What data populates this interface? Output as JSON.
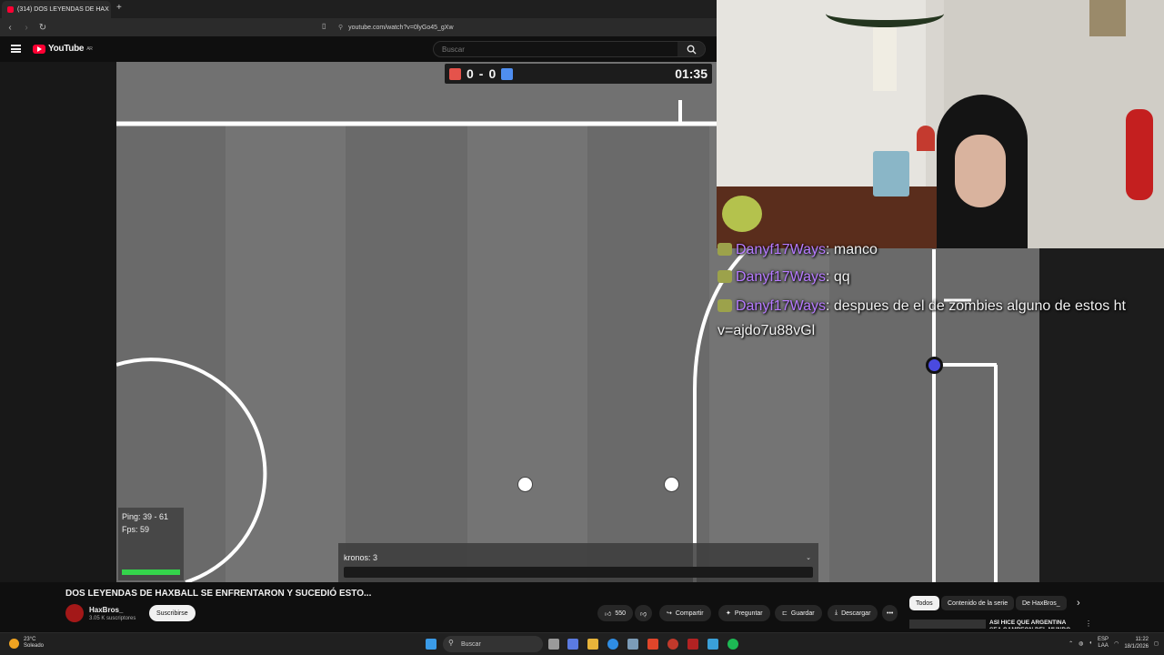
{
  "browser": {
    "tab_title": "(314) DOS LEYENDAS DE HAX",
    "tab_close": "×",
    "new_tab": "+",
    "url": "youtube.com/watch?v=0lyGo45_gXw"
  },
  "youtube": {
    "logo_text": "YouTube",
    "region": "AR",
    "search_placeholder": "Buscar"
  },
  "game": {
    "score_red": "0",
    "score_sep": "-",
    "score_blue": "0",
    "clock": "01:35",
    "ping": "Ping: 39 - 61",
    "fps": "Fps: 59",
    "chat_line": "kronos: 3",
    "colors": {
      "red": "#e5534b",
      "blue": "#4f8ef0",
      "player": "#4a4ae0"
    }
  },
  "stream_chat": [
    {
      "user": "Danyf17Ways",
      "text": "manco"
    },
    {
      "user": "Danyf17Ways",
      "text": "qq"
    },
    {
      "user": "Danyf17Ways",
      "text": "despues de el de zombies alguno de estos ht"
    }
  ],
  "stream_chat_cont": "v=ajdo7u88vGl",
  "video_info": {
    "title": "DOS LEYENDAS DE HAXBALL SE ENFRENTARON Y SUCEDIÓ ESTO...",
    "channel": "HaxBros_",
    "subs": "3.05 K suscriptores",
    "subscribe": "Suscribirse",
    "likes": "550",
    "share": "Compartir",
    "ask": "Preguntar",
    "save": "Guardar",
    "download": "Descargar",
    "more": "•••"
  },
  "chips": [
    "Todos",
    "Contenido de la serie",
    "De HaxBros_"
  ],
  "suggestion": {
    "title": "ASÍ HICE QUE ARGENTINA SEA CAMPEON DEL MUNDO POR"
  },
  "taskbar": {
    "temp": "23°C",
    "condition": "Soleado",
    "search": "Buscar",
    "lang1": "ESP",
    "lang2": "LAA",
    "time": "11:22",
    "date": "18/1/2026"
  }
}
